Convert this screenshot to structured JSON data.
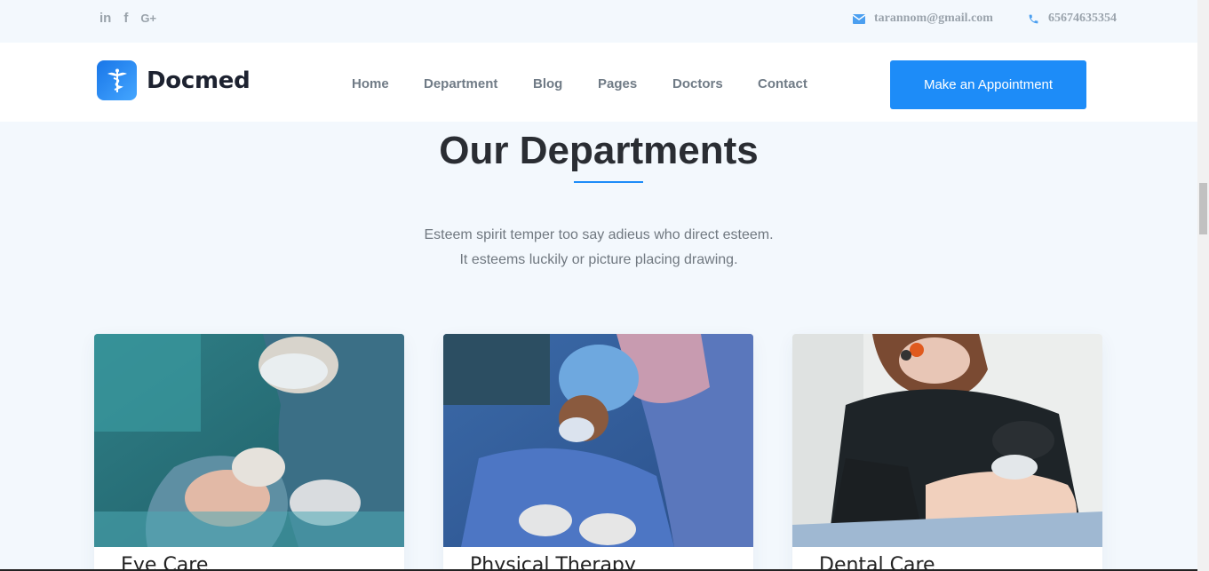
{
  "topbar": {
    "social": [
      {
        "label": "in",
        "icon": "linkedin-icon"
      },
      {
        "label": "f",
        "icon": "facebook-icon"
      },
      {
        "label": "G+",
        "icon": "google-plus-icon"
      }
    ],
    "email": "tarannom@gmail.com",
    "phone": "65674635354",
    "icon_color": "#4b9ff0"
  },
  "brand": {
    "name": "Docmed",
    "logo_icon": "caduceus-icon",
    "accent": "#1d8cf8"
  },
  "nav": {
    "items": [
      "Home",
      "Department",
      "Blog",
      "Pages",
      "Doctors",
      "Contact"
    ],
    "cta_label": "Make an Appointment"
  },
  "section": {
    "title": "Our Departments",
    "subtitle_lines": [
      "Esteem spirit temper too say adieus who direct esteem.",
      "It esteems luckily or picture placing drawing."
    ]
  },
  "cards": [
    {
      "title": "Eye Care",
      "image": "eye-surgery-photo"
    },
    {
      "title": "Physical Therapy",
      "image": "surgery-team-photo"
    },
    {
      "title": "Dental Care",
      "image": "dentist-photo"
    }
  ]
}
